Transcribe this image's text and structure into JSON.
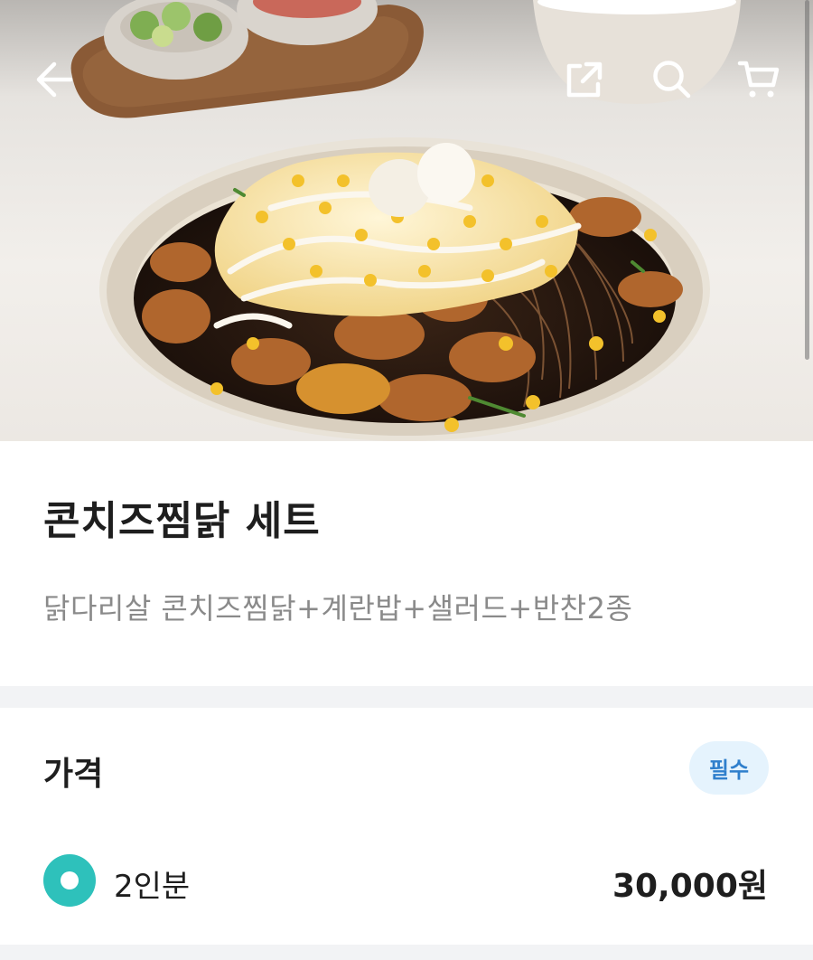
{
  "header": {
    "back_icon": "arrow-left-icon",
    "share_icon": "share-icon",
    "search_icon": "search-icon",
    "cart_icon": "cart-icon"
  },
  "product": {
    "image": "hero-food-photo",
    "title": "콘치즈찜닭 세트",
    "description": "닭다리살 콘치즈찜닭+계란밥+샐러드+반찬2종"
  },
  "price_section": {
    "title": "가격",
    "badge": "필수",
    "options": [
      {
        "label": "2인분",
        "price": "30,000원",
        "selected": true
      }
    ]
  },
  "colors": {
    "accent_teal": "#2EC1BB",
    "badge_bg": "#E5F3FD",
    "badge_text": "#2F7FCC",
    "divider": "#F2F3F5"
  }
}
